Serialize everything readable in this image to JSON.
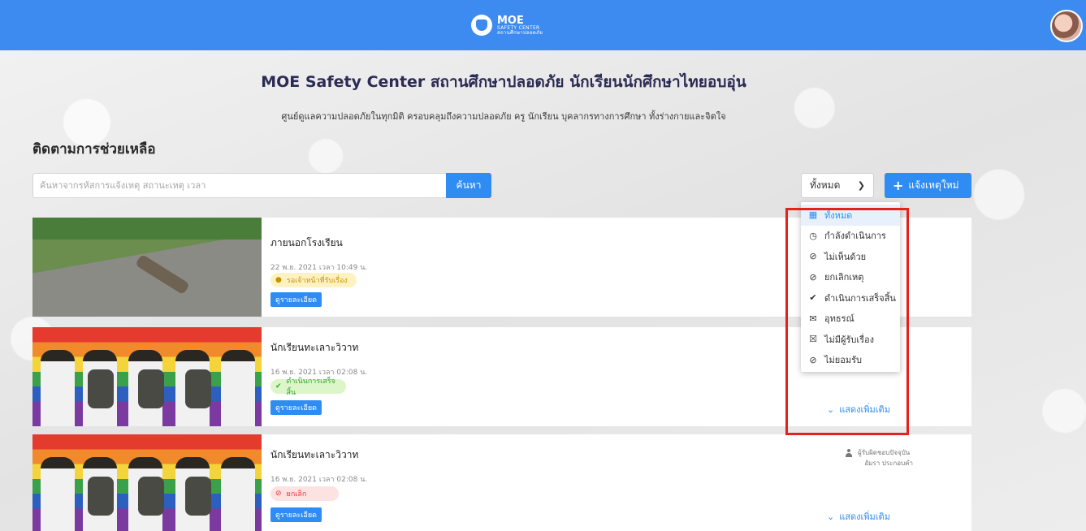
{
  "header": {
    "logo_main": "MOE",
    "logo_sub": "SAFETY CENTER",
    "logo_tag": "สถานศึกษาปลอดภัย",
    "brand_color": "#3d8bf0"
  },
  "hero": {
    "title": "MOE Safety Center สถานศึกษาปลอดภัย นักเรียนนักศึกษาไทยอบอุ่น",
    "subtitle": "ศูนย์ดูแลความปลอดภัยในทุกมิติ ครอบคลุมถึงความปลอดภัย ครู นักเรียน บุคลากรทางการศึกษา ทั้งร่างกายและจิตใจ"
  },
  "section_title": "ติดตามการช่วยเหลือ",
  "search": {
    "placeholder": "ค้นหาจากรหัสการแจ้งเหตุ สถานะเหตุ เวลา",
    "button_label": "ค้นหา"
  },
  "filter": {
    "selected": "ทั้งหมด",
    "options": [
      {
        "label": "ทั้งหมด",
        "icon": "grid-icon"
      },
      {
        "label": "กำลังดำเนินการ",
        "icon": "clock-icon"
      },
      {
        "label": "ไม่เห็นด้วย",
        "icon": "ban-icon"
      },
      {
        "label": "ยกเลิกเหตุ",
        "icon": "ban-icon"
      },
      {
        "label": "ดำเนินการเสร็จสิ้น",
        "icon": "check-icon"
      },
      {
        "label": "อุทธรณ์",
        "icon": "envelope-open-icon"
      },
      {
        "label": "ไม่มีผู้รับเรื่อง",
        "icon": "user-slash-icon"
      },
      {
        "label": "ไม่ยอมรับ",
        "icon": "ban-icon"
      }
    ]
  },
  "new_report_button": "แจ้งเหตุใหม่",
  "cases": [
    {
      "title": "ภายนอกโรงเรียน",
      "date": "22 พ.ย. 2021 เวลา 10:49 น.",
      "status": "รอเจ้าหน้าที่รับเรื่อง",
      "status_color": "#c79200",
      "detail_label": "ดูรายละเอียด"
    },
    {
      "title": "นักเรียนทะเลาะวิวาท",
      "date": "16 พ.ย. 2021 เวลา 02:08 น.",
      "status": "ดำเนินการเสร็จสิ้น",
      "status_color": "#3aa335",
      "detail_label": "ดูรายละเอียด",
      "show_more": "แสดงเพิ่มเติม"
    },
    {
      "title": "นักเรียนทะเลาะวิวาท",
      "date": "16 พ.ย. 2021 เวลา 02:08 น.",
      "status": "ยกเลิก",
      "status_color": "#e23a3a",
      "detail_label": "ดูรายละเอียด",
      "show_more": "แสดงเพิ่มเติม",
      "responsible_label": "ผู้รับผิดชอบปัจจุบัน",
      "responsible_name": "อัมรา ประกอบคำ"
    }
  ]
}
